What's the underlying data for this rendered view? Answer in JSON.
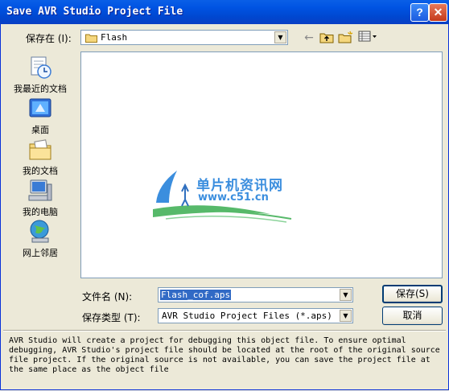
{
  "window": {
    "title": "Save AVR Studio Project File",
    "help_label": "?",
    "close_label": "✕"
  },
  "save_in": {
    "label": "保存在 (I):",
    "value": "Flash"
  },
  "places": [
    {
      "label": "我最近的文档",
      "icon": "recent-documents-icon"
    },
    {
      "label": "桌面",
      "icon": "desktop-icon"
    },
    {
      "label": "我的文档",
      "icon": "my-documents-icon"
    },
    {
      "label": "我的电脑",
      "icon": "my-computer-icon"
    },
    {
      "label": "网上邻居",
      "icon": "network-places-icon"
    }
  ],
  "watermark": {
    "line1": "单片机资讯网",
    "line2": "www.c51.cn"
  },
  "filename": {
    "label": "文件名 (N):",
    "value": "Flash_cof.aps"
  },
  "filetype": {
    "label": "保存类型 (T):",
    "value": "AVR Studio Project Files (*.aps)"
  },
  "buttons": {
    "save": "保存(S)",
    "cancel": "取消"
  },
  "description": "AVR Studio will create a project for debugging this object file. To ensure optimal\ndebugging, AVR Studio's project file should be located at the root of the original source\nfile project. If the original source is not available, you can save the project file at\nthe same place as the object file"
}
